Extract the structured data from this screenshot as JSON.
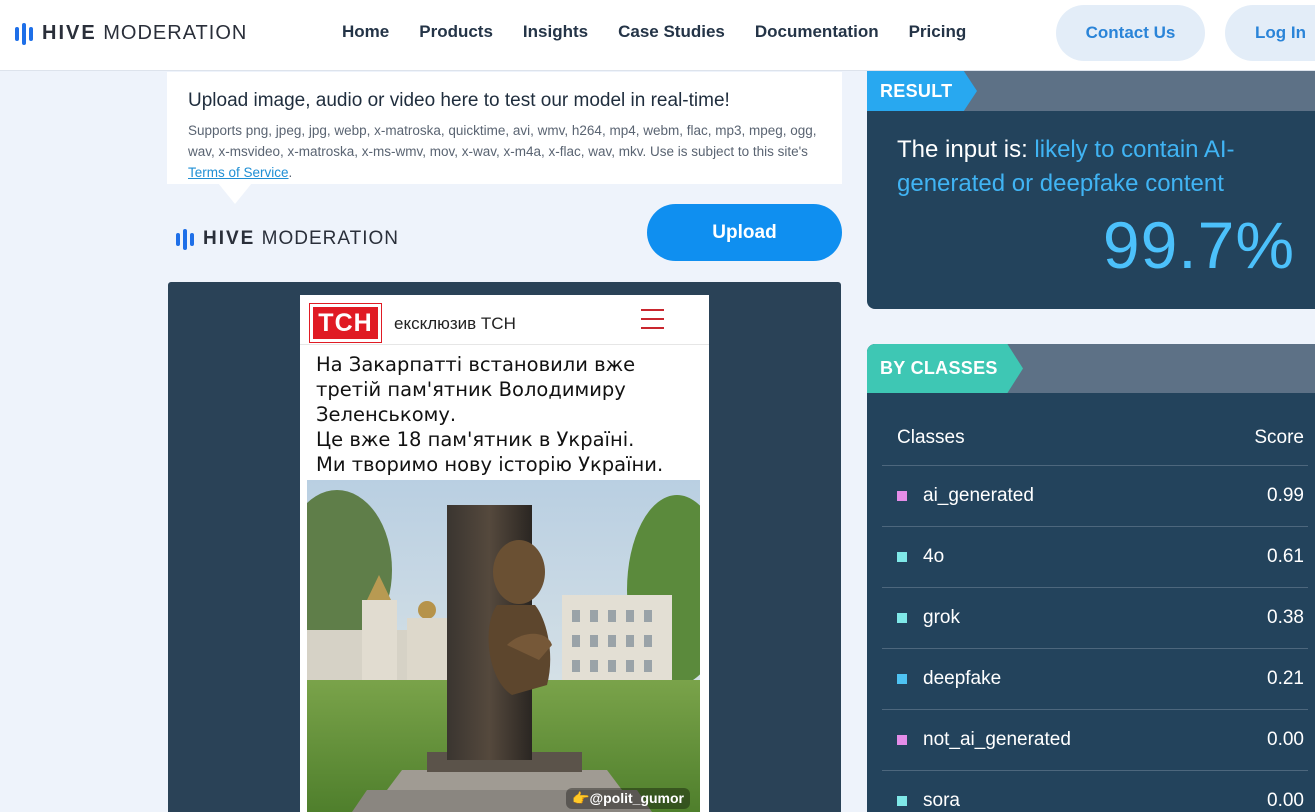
{
  "header": {
    "logo_bold": "HIVE",
    "logo_light": "MODERATION",
    "nav": [
      "Home",
      "Products",
      "Insights",
      "Case Studies",
      "Documentation",
      "Pricing"
    ],
    "contact_label": "Contact Us",
    "login_label": "Log In"
  },
  "upload": {
    "title": "Upload image, audio or video here to test our model in real-time!",
    "formats_text": "Supports png, jpeg, jpg, webp, x-matroska, quicktime, avi, wmv, h264, mp4, webm, flac, mp3, mpeg, ogg, wav, x-msvideo, x-matroska, x-ms-wmv, mov, x-wav, x-m4a, x-flac, wav, mkv. Use is subject to this site's ",
    "tos_link": "Terms of Service",
    "tos_suffix": ".",
    "button_label": "Upload",
    "logo_bold": "HIVE",
    "logo_light": "MODERATION"
  },
  "preview": {
    "badge": "TCH",
    "source": "ексклюзив ТСН",
    "lines": [
      "На Закарпатті встановили вже",
      "третій пам'ятник Володимиру",
      "Зеленському.",
      "Це вже 18 пам'ятник в Україні.",
      "Ми творимо нову історію України."
    ],
    "watermark": "👉@polit_gumor"
  },
  "result": {
    "tag": "RESULT",
    "prefix": "The input is: ",
    "verdict": "likely to contain AI-generated or deepfake content",
    "score": "99.7%"
  },
  "classes": {
    "tag": "BY CLASSES",
    "col_classes": "Classes",
    "col_score": "Score",
    "rows": [
      {
        "name": "ai_generated",
        "score": "0.99",
        "color": "#e48de8"
      },
      {
        "name": "4o",
        "score": "0.61",
        "color": "#7fe8e8"
      },
      {
        "name": "grok",
        "score": "0.38",
        "color": "#7fe8e8"
      },
      {
        "name": "deepfake",
        "score": "0.21",
        "color": "#4ec3f3"
      },
      {
        "name": "not_ai_generated",
        "score": "0.00",
        "color": "#e48de8"
      },
      {
        "name": "sora",
        "score": "0.00",
        "color": "#7fe8e8"
      }
    ]
  }
}
